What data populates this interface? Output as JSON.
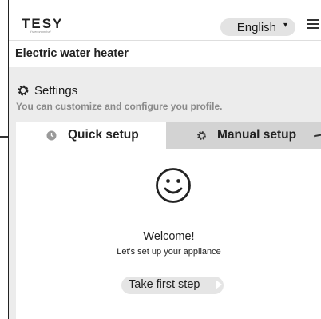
{
  "header": {
    "logo": "TESY",
    "tagline": "It's economical",
    "language": "English",
    "caret_icon": "caret-down-icon",
    "menu_icon": "hamburger-menu-icon"
  },
  "page": {
    "title": "Electric water heater"
  },
  "settings": {
    "icon": "gear-icon",
    "title": "Settings",
    "subtitle": "You can customize and configure you profile."
  },
  "tabs": [
    {
      "label": "Quick setup",
      "icon": "clock-icon",
      "active": true
    },
    {
      "label": "Manual setup",
      "icon": "gear-icon",
      "active": false
    }
  ],
  "welcome": {
    "icon": "smiley-icon",
    "heading": "Welcome!",
    "message": "Let's set up your appliance",
    "button_label": "Take first step",
    "button_icon": "arrow-right-icon"
  },
  "colors": {
    "panel": "#ececec",
    "active_tab": "#ffffff",
    "inactive_tab": "#d3d3d3",
    "pill": "#e3e3e3"
  }
}
